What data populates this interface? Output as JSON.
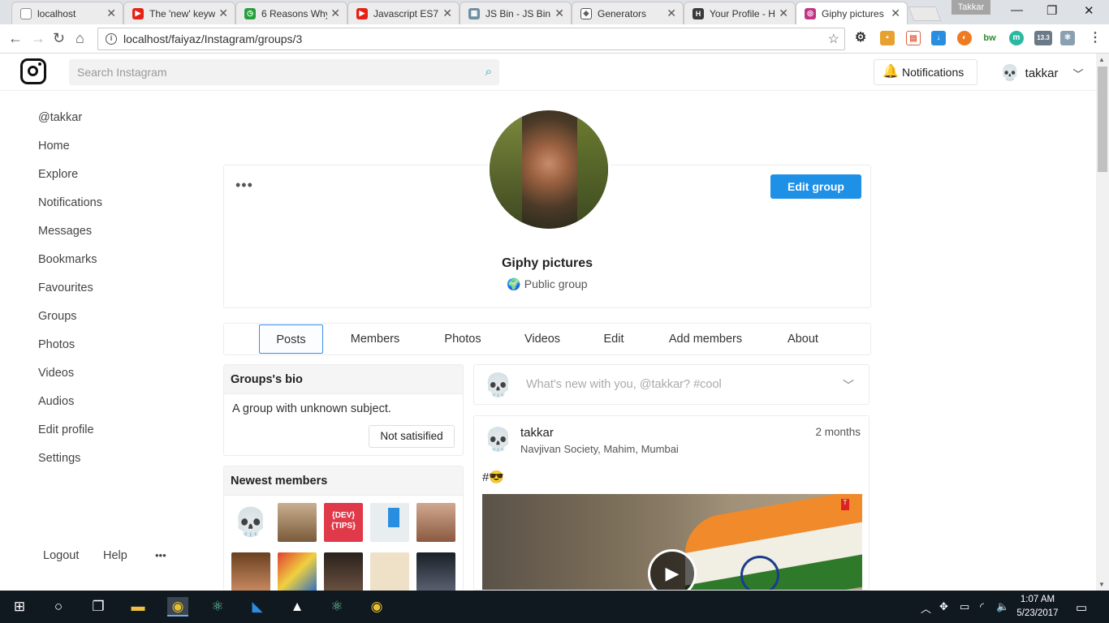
{
  "browser": {
    "tabs": [
      {
        "title": "localhost",
        "favicon_color": "#8d8d8d"
      },
      {
        "title": "The 'new' keyw",
        "favicon_color": "#e62117"
      },
      {
        "title": "6 Reasons Why",
        "favicon_color": "#26a03c"
      },
      {
        "title": "Javascript ES7",
        "favicon_color": "#e62117"
      },
      {
        "title": "JS Bin - JS Bin",
        "favicon_color": "#6f8ea0"
      },
      {
        "title": "Generators",
        "favicon_color": "#555555"
      },
      {
        "title": "Your Profile - H",
        "favicon_color": "#3a3a3a"
      },
      {
        "title": "Giphy pictures",
        "favicon_color": "#c13584"
      }
    ],
    "profile_name": "Takkar",
    "url": "localhost/faiyaz/Instagram/groups/3",
    "extension_badge": "13.3"
  },
  "header": {
    "search_placeholder": "Search Instagram",
    "notifications_label": "Notifications",
    "username": "takkar"
  },
  "sidebar": {
    "items": [
      "@takkar",
      "Home",
      "Explore",
      "Notifications",
      "Messages",
      "Bookmarks",
      "Favourites",
      "Groups",
      "Photos",
      "Videos",
      "Audios",
      "Edit profile",
      "Settings"
    ],
    "footer": {
      "logout": "Logout",
      "help": "Help",
      "more": "•••"
    }
  },
  "group": {
    "more": "•••",
    "edit_label": "Edit group",
    "name": "Giphy pictures",
    "type": "Public group",
    "tabs": [
      "Posts",
      "Members",
      "Photos",
      "Videos",
      "Edit",
      "Add members",
      "About"
    ],
    "active_tab": "Posts"
  },
  "bio": {
    "title": "Groups's bio",
    "text": "A group with unknown subject.",
    "button": "Not satisified"
  },
  "newest_members": {
    "title": "Newest members",
    "thumbnail_colors": [
      "#ffffff",
      "#8a6a4a",
      "#e03a4a",
      "#dfe6ea",
      "#b88870",
      "#6a4020",
      "#d84030",
      "#3a2e26",
      "#efe0c8",
      "#2a3038"
    ]
  },
  "composer": {
    "placeholder": "What's new with you, @takkar? #cool"
  },
  "post": {
    "username": "takkar",
    "location": "Navjivan Society, Mahim, Mumbai",
    "time": "2 months",
    "text": "#😎"
  },
  "taskbar": {
    "time": "1:07 AM",
    "date": "5/23/2017"
  },
  "colors": {
    "primary_button": "#1e90e6",
    "active_tab_border": "#3b8ee8"
  }
}
